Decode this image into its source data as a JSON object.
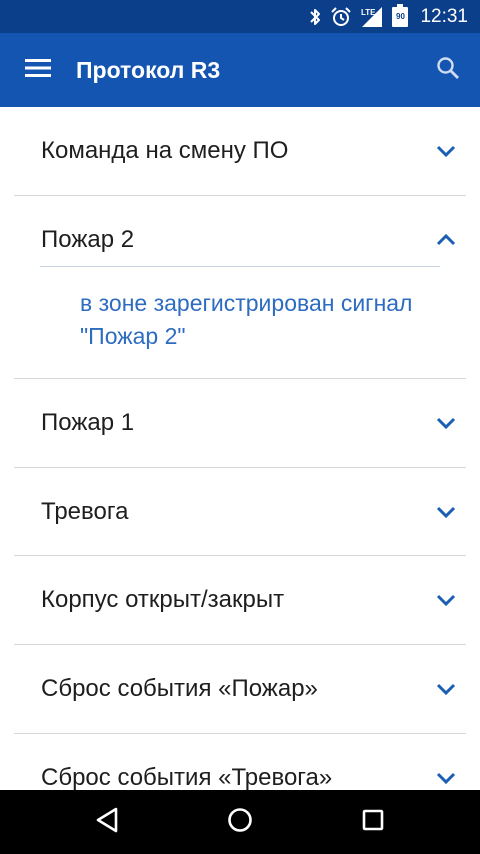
{
  "status_bar": {
    "time": "12:31",
    "battery": "90",
    "network": "LTE",
    "icons": [
      "bluetooth-icon",
      "alarm-icon",
      "lte-signal-icon",
      "battery-icon"
    ]
  },
  "app_bar": {
    "title": "Протокол R3",
    "icons": [
      "menu-icon",
      "search-icon"
    ]
  },
  "items": [
    {
      "title": "Команда на смену ПО",
      "expanded": false
    },
    {
      "title": "Пожар 2",
      "expanded": true,
      "detail": "в зоне зарегистрирован сигнал \"Пожар 2\""
    },
    {
      "title": "Пожар 1",
      "expanded": false
    },
    {
      "title": "Тревога",
      "expanded": false
    },
    {
      "title": "Корпус открыт/закрыт",
      "expanded": false
    },
    {
      "title": "Сброс события «Пожар»",
      "expanded": false
    },
    {
      "title": "Сброс события «Тревога»",
      "expanded": false
    }
  ],
  "nav_bar": {
    "icons": [
      "back-icon",
      "home-icon",
      "recents-icon"
    ]
  },
  "colors": {
    "status_bar": "#0c3f8a",
    "app_bar": "#1455b1",
    "accent": "#1a5fb4",
    "detail_text": "#2d6cc0"
  }
}
